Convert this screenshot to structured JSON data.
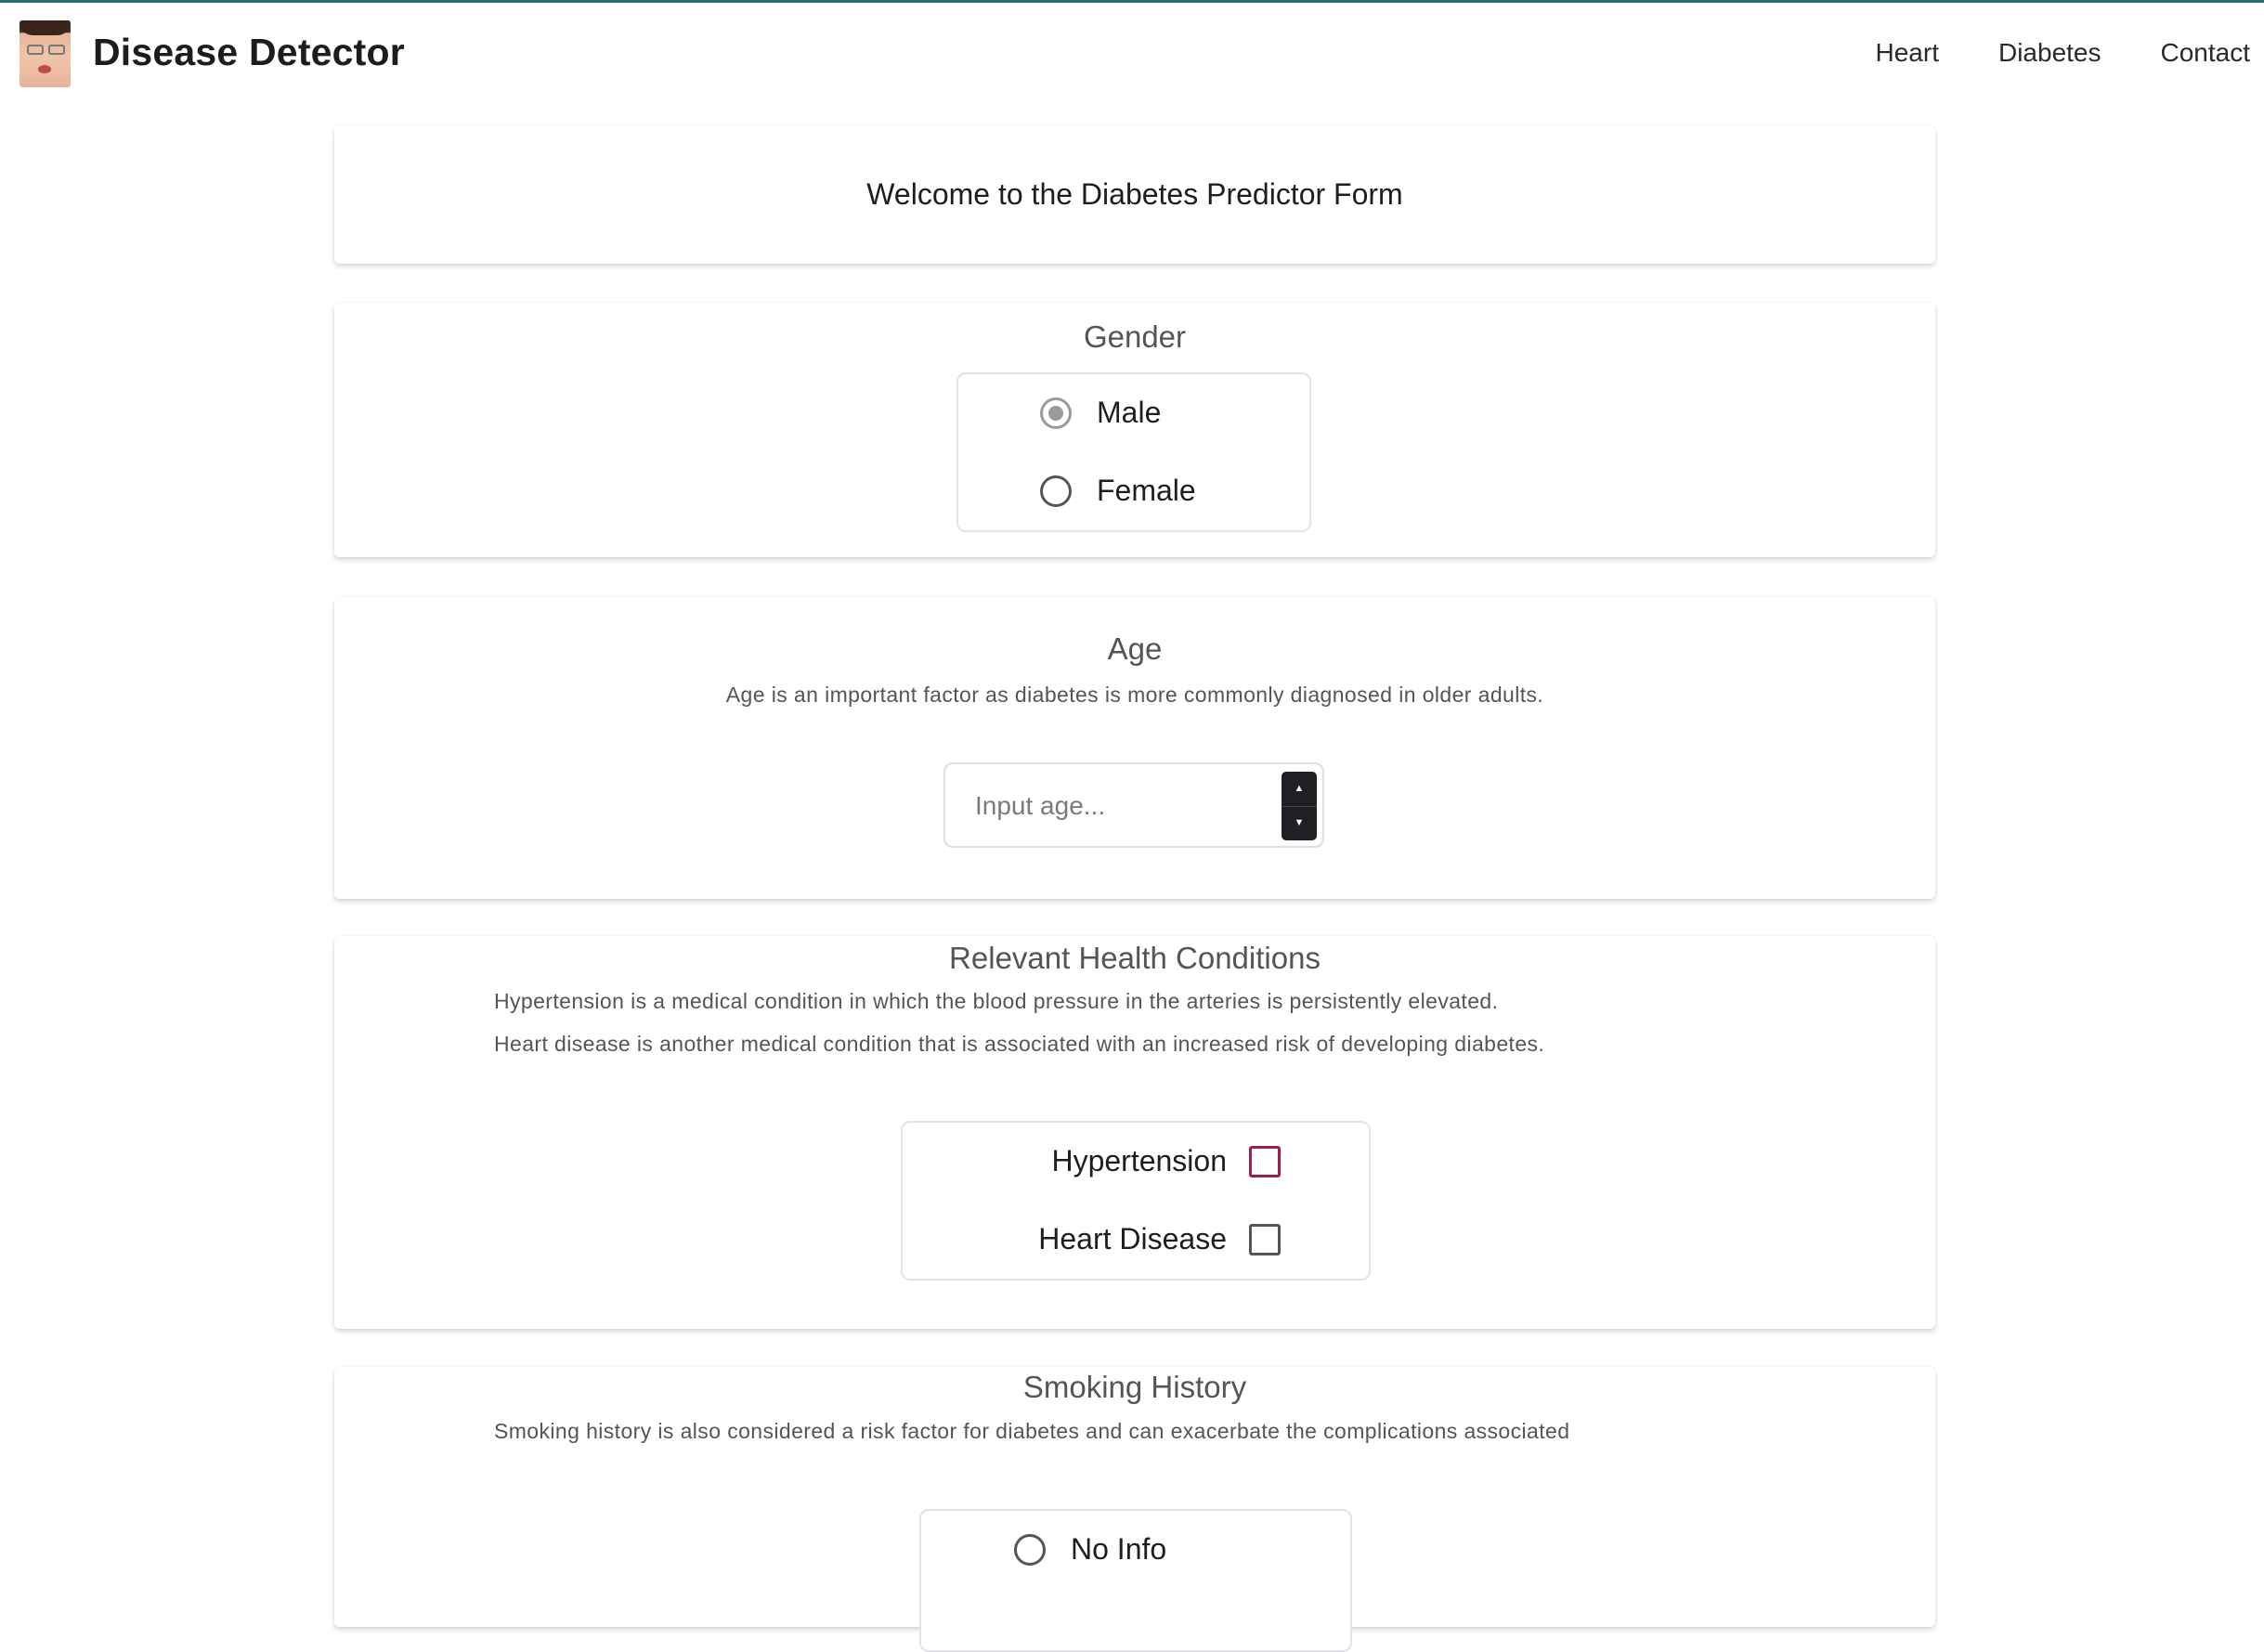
{
  "nav": {
    "brand": "Disease Detector",
    "links": [
      "Heart",
      "Diabetes",
      "Contact"
    ]
  },
  "welcome": "Welcome to the Diabetes Predictor Form",
  "gender": {
    "title": "Gender",
    "options": [
      "Male",
      "Female"
    ],
    "selected": "Male"
  },
  "age": {
    "title": "Age",
    "description": "Age is an important factor as diabetes is more commonly diagnosed in older adults.",
    "placeholder": "Input age...",
    "spinner_up": "▲",
    "spinner_down": "▼"
  },
  "conditions": {
    "title": "Relevant Health Conditions",
    "description_1": "Hypertension is a medical condition in which the blood pressure in the arteries is persistently elevated.",
    "description_2": "Heart disease is another medical condition that is associated with an increased risk of developing diabetes.",
    "options": [
      "Hypertension",
      "Heart Disease"
    ]
  },
  "smoking": {
    "title": "Smoking History",
    "description": "Smoking history is also considered a risk factor for diabetes and can exacerbate the complications associated",
    "options": [
      "No Info"
    ]
  },
  "colors": {
    "accent_checkbox": "#a01b4f",
    "top_line": "#2f6b73"
  },
  "icons": {
    "logo": "user-avatar-photo"
  }
}
